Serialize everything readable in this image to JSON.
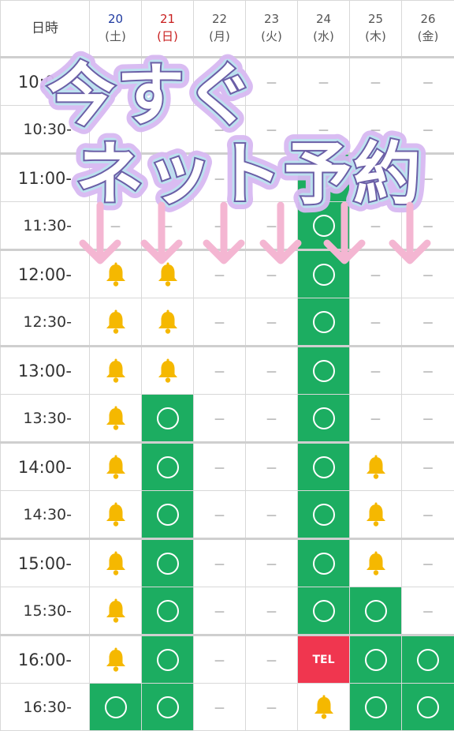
{
  "header": {
    "time_label": "日時",
    "days": [
      {
        "date": "20",
        "weekday": "(土)",
        "kind": "sat"
      },
      {
        "date": "21",
        "weekday": "(日)",
        "kind": "sun"
      },
      {
        "date": "22",
        "weekday": "(月)",
        "kind": "weekday"
      },
      {
        "date": "23",
        "weekday": "(火)",
        "kind": "weekday"
      },
      {
        "date": "24",
        "weekday": "(水)",
        "kind": "weekday"
      },
      {
        "date": "25",
        "weekday": "(木)",
        "kind": "weekday"
      },
      {
        "date": "26",
        "weekday": "(金)",
        "kind": "weekday"
      }
    ]
  },
  "legend": {
    "available": "〇",
    "unavailable": "－",
    "phone": "TEL",
    "bell_icon": "bell-icon"
  },
  "colors": {
    "available": "#1cad61",
    "phone": "#f0364f",
    "bell": "#f5b800",
    "banner_outline": "#d8b9f2",
    "arrow": "#f4b6d2"
  },
  "rows": [
    {
      "time": "10:00-",
      "hour": true,
      "cells": [
        "",
        "",
        "-",
        "-",
        "-",
        "-",
        "-"
      ]
    },
    {
      "time": "10:30-",
      "hour": false,
      "cells": [
        "",
        "",
        "-",
        "-",
        "-",
        "-",
        "-"
      ]
    },
    {
      "time": "11:00-",
      "hour": true,
      "cells": [
        "",
        "",
        "-",
        "-",
        "ok",
        "-",
        "-"
      ]
    },
    {
      "time": "11:30-",
      "hour": false,
      "cells": [
        "-",
        "-",
        "-",
        "-",
        "ok",
        "-",
        "-"
      ]
    },
    {
      "time": "12:00-",
      "hour": true,
      "cells": [
        "bell",
        "bell",
        "-",
        "-",
        "ok",
        "-",
        "-"
      ]
    },
    {
      "time": "12:30-",
      "hour": false,
      "cells": [
        "bell",
        "bell",
        "-",
        "-",
        "ok",
        "-",
        "-"
      ]
    },
    {
      "time": "13:00-",
      "hour": true,
      "cells": [
        "bell",
        "bell",
        "-",
        "-",
        "ok",
        "-",
        "-"
      ]
    },
    {
      "time": "13:30-",
      "hour": false,
      "cells": [
        "bell",
        "ok",
        "-",
        "-",
        "ok",
        "-",
        "-"
      ]
    },
    {
      "time": "14:00-",
      "hour": true,
      "cells": [
        "bell",
        "ok",
        "-",
        "-",
        "ok",
        "bell",
        "-"
      ]
    },
    {
      "time": "14:30-",
      "hour": false,
      "cells": [
        "bell",
        "ok",
        "-",
        "-",
        "ok",
        "bell",
        "-"
      ]
    },
    {
      "time": "15:00-",
      "hour": true,
      "cells": [
        "bell",
        "ok",
        "-",
        "-",
        "ok",
        "bell",
        "-"
      ]
    },
    {
      "time": "15:30-",
      "hour": false,
      "cells": [
        "bell",
        "ok",
        "-",
        "-",
        "ok",
        "ok",
        "-"
      ]
    },
    {
      "time": "16:00-",
      "hour": true,
      "cells": [
        "bell",
        "ok",
        "-",
        "-",
        "tel",
        "ok",
        "ok"
      ]
    },
    {
      "time": "16:30-",
      "hour": false,
      "cells": [
        "ok",
        "ok",
        "-",
        "-",
        "bell",
        "ok",
        "ok"
      ]
    }
  ],
  "banner": {
    "line1": "今すぐ",
    "line2": "ネット予約"
  }
}
